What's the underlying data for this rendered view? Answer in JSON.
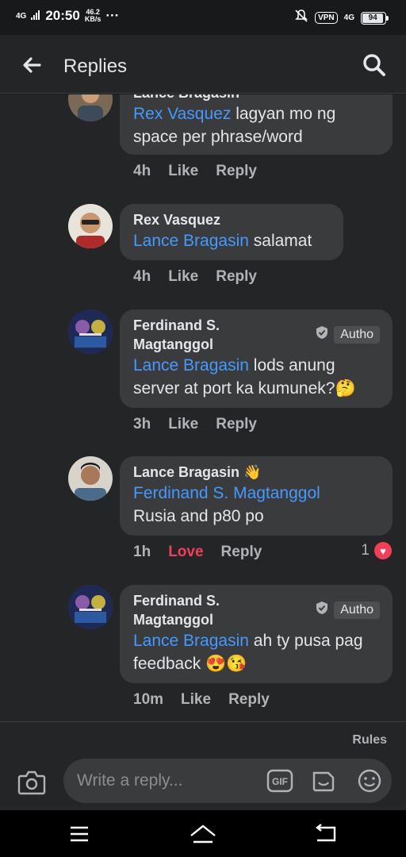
{
  "status_bar": {
    "network_type": "4G",
    "time": "20:50",
    "speed_value": "46.2",
    "speed_unit": "KB/s",
    "more": "···",
    "vpn_label": "VPN",
    "network_type_right": "4G",
    "battery_level": "94"
  },
  "header": {
    "title": "Replies",
    "back_icon": "arrow-left-icon",
    "search_icon": "search-icon"
  },
  "comments": [
    {
      "name": "Lance Bragasin",
      "mention": "Rex Vasquez",
      "text_line1": " lagyan mo ng",
      "text_line2": "space per phrase/word",
      "time": "4h",
      "like": "Like",
      "reply": "Reply"
    },
    {
      "name": "Rex Vasquez",
      "mention": "Lance Bragasin",
      "text": " salamat",
      "time": "4h",
      "like": "Like",
      "reply": "Reply"
    },
    {
      "name_line1": "Ferdinand S.",
      "name_line2": "Magtanggol",
      "badge": "Autho",
      "mention": "Lance Bragasin",
      "text_line1": " lods anung",
      "text_line2": "server at port ka kumunek?",
      "emoji": "🤔",
      "time": "3h",
      "like": "Like",
      "reply": "Reply"
    },
    {
      "name": "Lance Bragasin",
      "name_emoji": "👋",
      "mention": "Ferdinand S. Magtanggol",
      "text": "Rusia and p80 po",
      "time": "1h",
      "like": "Love",
      "reply": "Reply",
      "reaction_count": "1"
    },
    {
      "name_line1": "Ferdinand S.",
      "name_line2": "Magtanggol",
      "badge": "Autho",
      "mention": "Lance Bragasin",
      "text_line1": " ah ty pusa pag",
      "text_line2": "feedback ",
      "emoji": "😍😘",
      "time": "10m",
      "like": "Like",
      "reply": "Reply"
    }
  ],
  "footer": {
    "rules": "Rules",
    "placeholder": "Write a reply...",
    "gif_label": "GIF"
  },
  "colors": {
    "background": "#18191a",
    "surface": "#242526",
    "bubble": "#3a3b3c",
    "mention": "#4599ff",
    "love": "#f33e58"
  }
}
